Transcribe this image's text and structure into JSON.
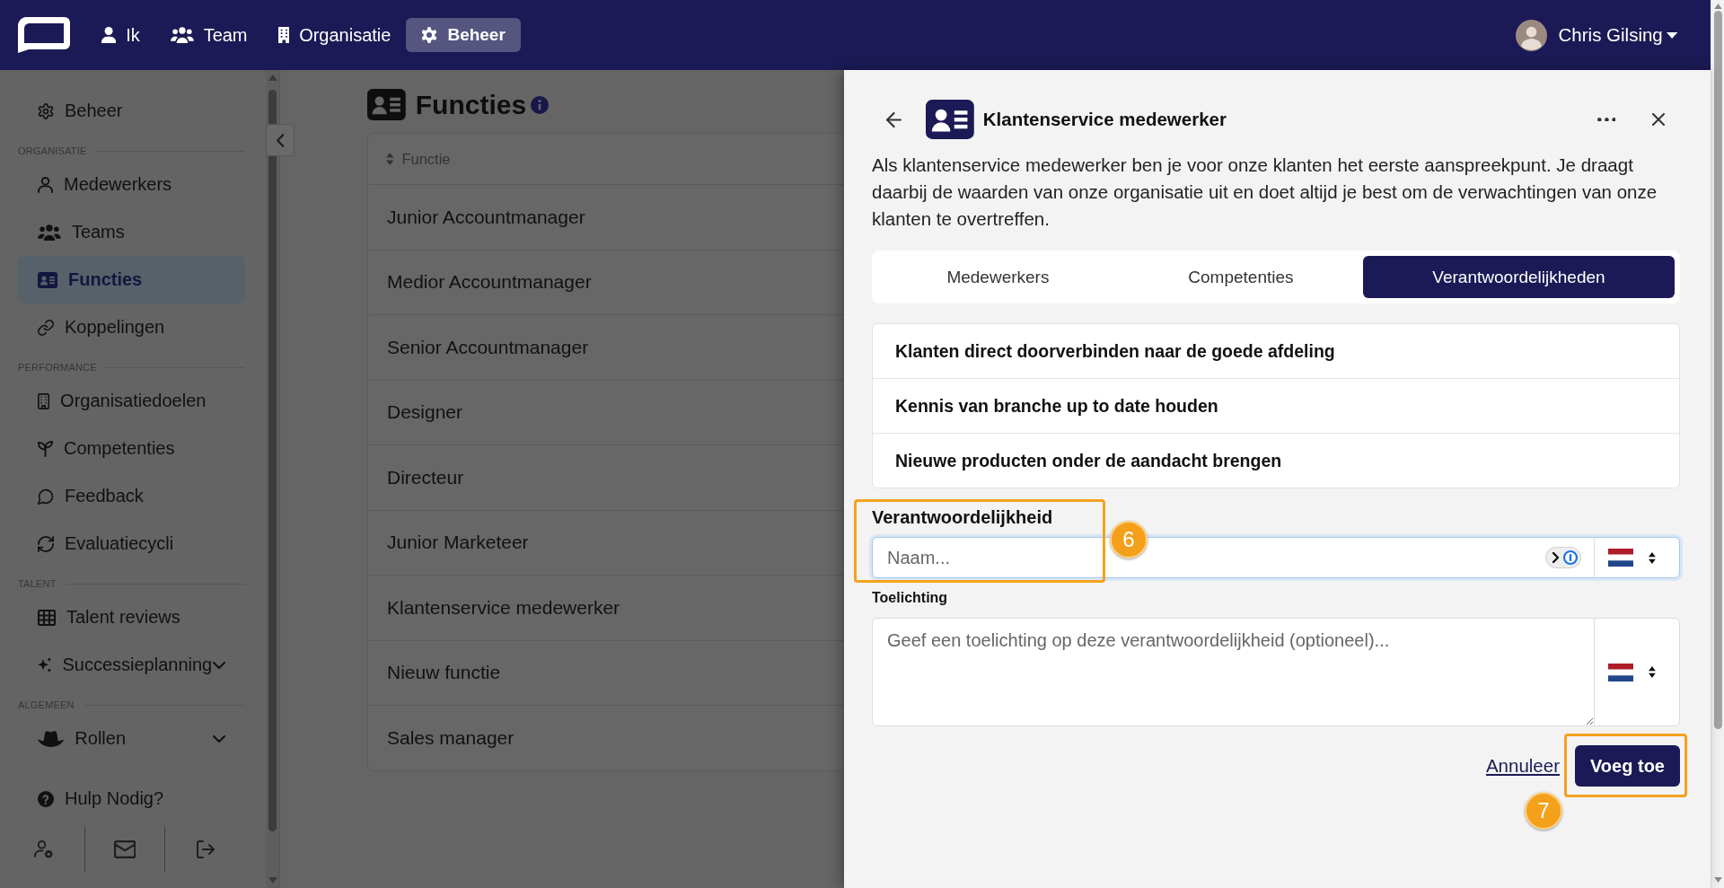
{
  "top_nav": {
    "items": [
      {
        "label": "Ik",
        "selected": false
      },
      {
        "label": "Team",
        "selected": false
      },
      {
        "label": "Organisatie",
        "selected": false
      },
      {
        "label": "Beheer",
        "selected": true
      }
    ],
    "user": {
      "name": "Chris Gilsing"
    }
  },
  "sidebar": {
    "sections": [
      {
        "items": [
          {
            "label": "Beheer",
            "selected": false,
            "expandable": false
          }
        ]
      },
      {
        "title": "ORGANISATIE",
        "items": [
          {
            "label": "Medewerkers",
            "selected": false,
            "expandable": false
          },
          {
            "label": "Teams",
            "selected": false,
            "expandable": false
          },
          {
            "label": "Functies",
            "selected": true,
            "expandable": false
          },
          {
            "label": "Koppelingen",
            "selected": false,
            "expandable": false
          }
        ]
      },
      {
        "title": "PERFORMANCE",
        "items": [
          {
            "label": "Organisatiedoelen",
            "selected": false,
            "expandable": false
          },
          {
            "label": "Competenties",
            "selected": false,
            "expandable": false
          },
          {
            "label": "Feedback",
            "selected": false,
            "expandable": false
          },
          {
            "label": "Evaluatiecycli",
            "selected": false,
            "expandable": false
          }
        ]
      },
      {
        "title": "TALENT",
        "items": [
          {
            "label": "Talent reviews",
            "selected": false,
            "expandable": false
          },
          {
            "label": "Successieplanning",
            "selected": false,
            "expandable": true
          }
        ]
      },
      {
        "title": "ALGEMEEN",
        "items": [
          {
            "label": "Rollen",
            "selected": false,
            "expandable": true
          }
        ]
      }
    ],
    "help": {
      "label": "Hulp Nodig?"
    }
  },
  "page": {
    "title": "Functies",
    "table": {
      "columns": [
        {
          "label": "Functie"
        }
      ],
      "rows": [
        [
          "Junior Accountmanager"
        ],
        [
          "Medior Accountmanager"
        ],
        [
          "Senior Accountmanager"
        ],
        [
          "Designer"
        ],
        [
          "Directeur"
        ],
        [
          "Junior Marketeer"
        ],
        [
          "Klantenservice medewerker"
        ],
        [
          "Nieuw functie"
        ],
        [
          "Sales manager"
        ]
      ]
    }
  },
  "panel": {
    "title": "Klantenservice medewerker",
    "description": "Als klantenservice medewerker ben je voor onze klanten het eerste aanspreekpunt. Je draagt daarbij de waarden van onze organisatie uit en doet altijd je best om de verwachtingen van onze klanten te overtreffen.",
    "tabs": [
      {
        "label": "Medewerkers",
        "selected": false
      },
      {
        "label": "Competenties",
        "selected": false
      },
      {
        "label": "Verantwoordelijkheden",
        "selected": true
      }
    ],
    "responsibilities": [
      "Klanten direct doorverbinden naar de goede afdeling",
      "Kennis van branche up to date houden",
      "Nieuwe producten onder de aandacht brengen"
    ],
    "form": {
      "fields": [
        {
          "kind": "input",
          "label": "Verantwoordelijkheid",
          "placeholder": "Naam...",
          "focused": true,
          "annotation": "6"
        },
        {
          "kind": "textarea",
          "label": "Toelichting",
          "placeholder": "Geef een toelichting op deze verantwoordelijkheid (optioneel)...",
          "focused": false
        }
      ],
      "cancel": {
        "label": "Annuleer"
      },
      "submit": {
        "label": "Voeg toe",
        "annotation": "7"
      }
    }
  }
}
